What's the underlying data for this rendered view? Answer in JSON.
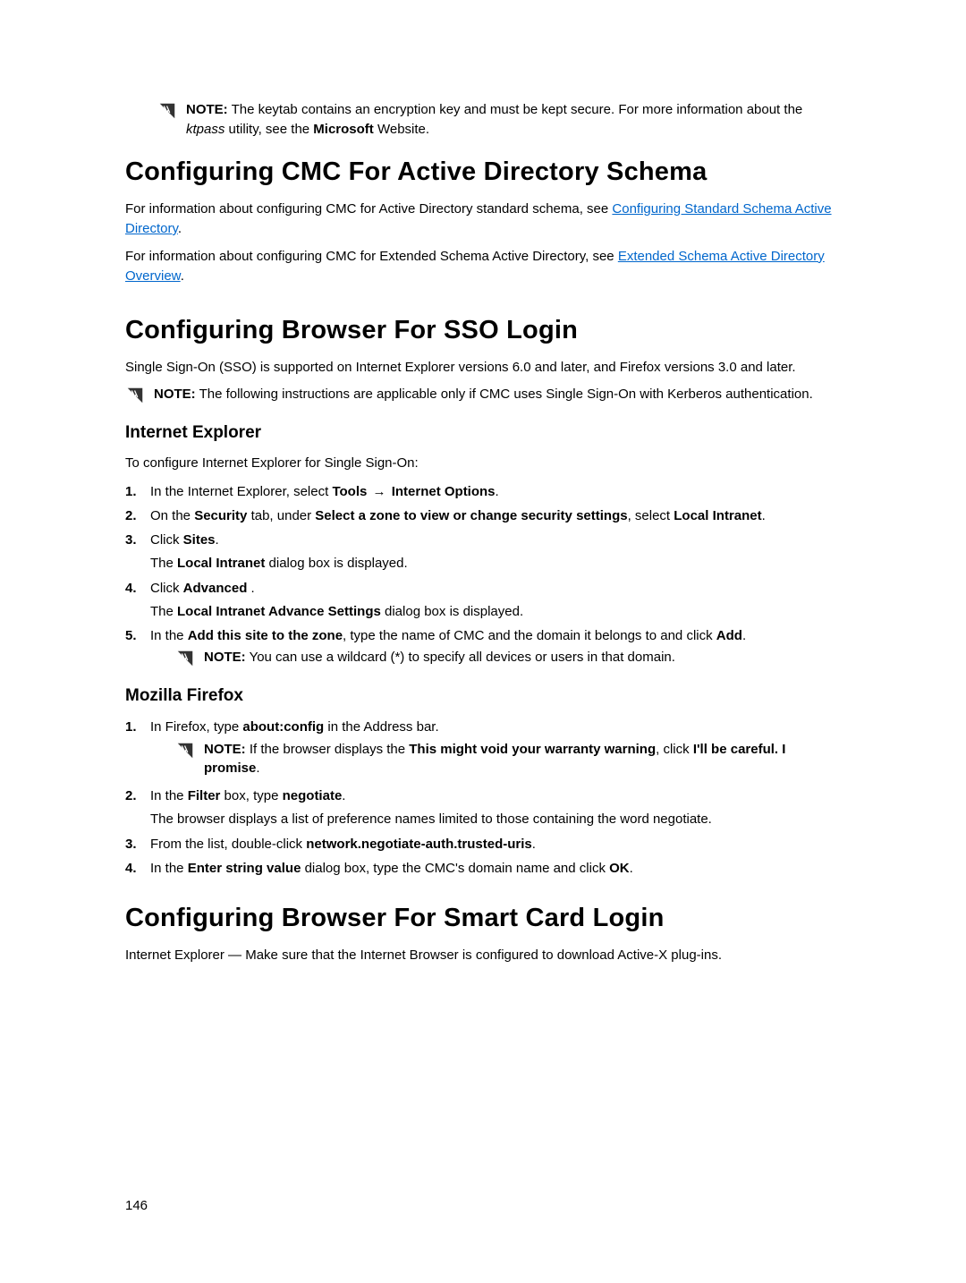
{
  "topnote": {
    "label": "NOTE:",
    "text1": " The keytab contains an encryption key and must be kept secure. For more information about the ",
    "ktpass": "ktpass",
    "text2": " utility, see the ",
    "ms": "Microsoft",
    "text3": " Website."
  },
  "sec1": {
    "title": "Configuring CMC For Active Directory Schema",
    "p1a": "For information about configuring CMC for Active Directory standard schema, see ",
    "link1": "Configuring Standard Schema Active Directory",
    "p1b": ".",
    "p2a": "For information about configuring CMC for Extended Schema Active Directory, see ",
    "link2": "Extended Schema Active Directory Overview",
    "p2b": "."
  },
  "sec2": {
    "title": "Configuring Browser For SSO Login",
    "p1": "Single Sign-On (SSO) is supported on Internet Explorer versions 6.0 and later, and Firefox versions 3.0 and later.",
    "note": {
      "label": "NOTE:",
      "text": " The following instructions are applicable only if CMC uses Single Sign-On with Kerberos authentication."
    },
    "ie": {
      "title": "Internet Explorer",
      "intro": "To configure Internet Explorer for Single Sign-On:",
      "s1a": "In the Internet Explorer, select ",
      "s1b": "Tools",
      "s1arrow": " → ",
      "s1c": "Internet Options",
      "s1d": ".",
      "s2a": "On the ",
      "s2b": "Security",
      "s2c": " tab, under ",
      "s2d": "Select a zone to view or change security settings",
      "s2e": ", select ",
      "s2f": "Local Intranet",
      "s2g": ".",
      "s3a": "Click ",
      "s3b": "Sites",
      "s3c": ".",
      "s3sub1a": "The ",
      "s3sub1b": "Local Intranet",
      "s3sub1c": " dialog box is displayed.",
      "s4a": "Click ",
      "s4b": "Advanced",
      "s4c": " .",
      "s4sub1a": "The ",
      "s4sub1b": "Local Intranet Advance Settings",
      "s4sub1c": " dialog box is displayed.",
      "s5a": "In the ",
      "s5b": "Add this site to the zone",
      "s5c": ", type the name of CMC and the domain it belongs to and click ",
      "s5d": "Add",
      "s5e": ".",
      "s5note_label": "NOTE:",
      "s5note_text": " You can use a wildcard (*) to specify all devices or users in that domain."
    },
    "ff": {
      "title": "Mozilla Firefox",
      "s1a": "In Firefox, type ",
      "s1b": "about:config",
      "s1c": " in the Address bar.",
      "s1note_label": "NOTE:",
      "s1note_a": " If the browser displays the ",
      "s1note_b": "This might void your warranty warning",
      "s1note_c": ", click ",
      "s1note_d": "I'll be careful. I promise",
      "s1note_e": ".",
      "s2a": "In the ",
      "s2b": "Filter",
      "s2c": " box, type ",
      "s2d": "negotiate",
      "s2e": ".",
      "s2sub": "The browser displays a list of preference names limited to those containing the word negotiate.",
      "s3a": "From the list, double-click ",
      "s3b": "network.negotiate-auth.trusted-uris",
      "s3c": ".",
      "s4a": "In the ",
      "s4b": "Enter string value",
      "s4c": " dialog box, type the CMC's domain name and click ",
      "s4d": "OK",
      "s4e": "."
    }
  },
  "sec3": {
    "title": "Configuring Browser For Smart Card Login",
    "p1": "Internet Explorer — Make sure that the Internet Browser is configured to download Active-X plug-ins."
  },
  "page_number": "146"
}
